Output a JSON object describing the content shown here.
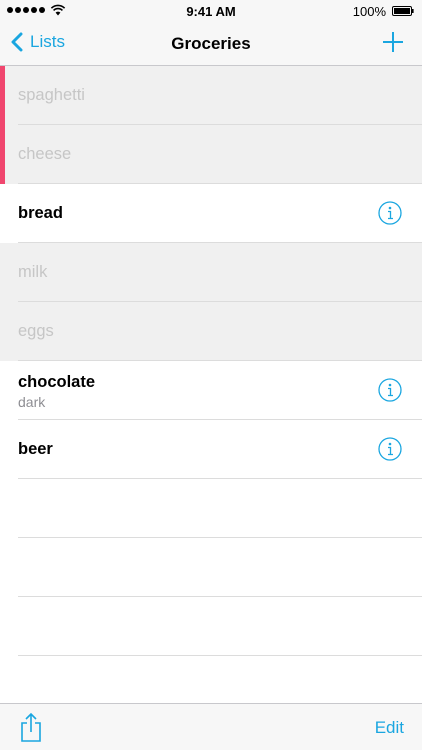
{
  "status_bar": {
    "time": "9:41 AM",
    "battery": "100%",
    "icons": [
      "signal-icon",
      "wifi-icon",
      "battery-icon"
    ]
  },
  "nav": {
    "back_label": "Lists",
    "title": "Groceries",
    "icons": [
      "chevron-left-icon",
      "plus-icon"
    ]
  },
  "items": [
    {
      "title": "spaghetti",
      "subtitle": "",
      "completed": true
    },
    {
      "title": "cheese",
      "subtitle": "",
      "completed": true
    },
    {
      "title": "bread",
      "subtitle": "",
      "completed": false
    },
    {
      "title": "milk",
      "subtitle": "",
      "completed": true
    },
    {
      "title": "eggs",
      "subtitle": "",
      "completed": true
    },
    {
      "title": "chocolate",
      "subtitle": "dark",
      "completed": false
    },
    {
      "title": "beer",
      "subtitle": "",
      "completed": false
    }
  ],
  "toolbar": {
    "edit_label": "Edit",
    "icons": [
      "share-icon"
    ]
  },
  "colors": {
    "accent": "#1aa6e0",
    "marker": "#f0466e",
    "completed_bg": "#f0f0f0",
    "completed_text": "#c6c6c6"
  }
}
